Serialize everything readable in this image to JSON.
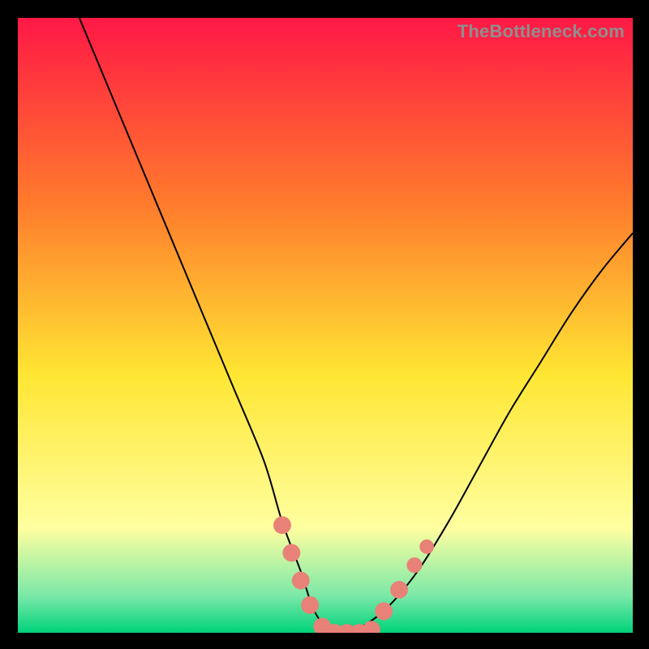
{
  "watermark": "TheBottleneck.com",
  "colors": {
    "bg_top": "#ff1846",
    "bg_mid1": "#ff7a2c",
    "bg_mid2": "#ffe633",
    "bg_low1": "#ffffa0",
    "bg_low2": "#7ae8a8",
    "bg_bottom": "#00d27a",
    "curve": "#000000",
    "marker": "#e88178",
    "black": "#000000"
  },
  "chart_data": {
    "type": "line",
    "title": "",
    "xlabel": "",
    "ylabel": "",
    "xlim": [
      0,
      100
    ],
    "ylim": [
      0,
      100
    ],
    "series": [
      {
        "name": "bottleneck-curve",
        "x": [
          10,
          15,
          20,
          25,
          30,
          35,
          40,
          43,
          46,
          48,
          50,
          52,
          54,
          56,
          60,
          65,
          70,
          75,
          80,
          85,
          90,
          95,
          100
        ],
        "values": [
          100,
          88,
          76,
          64,
          52,
          40,
          28,
          18,
          10,
          4,
          1,
          0,
          0,
          1,
          4,
          10,
          18,
          27,
          36,
          44,
          52,
          59,
          65
        ]
      }
    ],
    "markers": [
      {
        "x": 43.0,
        "y": 17.5,
        "r": 1.6
      },
      {
        "x": 44.5,
        "y": 13.0,
        "r": 1.6
      },
      {
        "x": 46.0,
        "y": 8.5,
        "r": 1.6
      },
      {
        "x": 47.5,
        "y": 4.5,
        "r": 1.6
      },
      {
        "x": 49.5,
        "y": 1.0,
        "r": 1.6
      },
      {
        "x": 51.5,
        "y": 0.0,
        "r": 1.6
      },
      {
        "x": 53.5,
        "y": 0.0,
        "r": 1.6
      },
      {
        "x": 55.5,
        "y": 0.0,
        "r": 1.6
      },
      {
        "x": 57.5,
        "y": 0.5,
        "r": 1.6
      },
      {
        "x": 59.5,
        "y": 3.5,
        "r": 1.6
      },
      {
        "x": 62.0,
        "y": 7.0,
        "r": 1.6
      },
      {
        "x": 64.5,
        "y": 11.0,
        "r": 1.4
      },
      {
        "x": 66.5,
        "y": 14.0,
        "r": 1.3
      }
    ]
  }
}
